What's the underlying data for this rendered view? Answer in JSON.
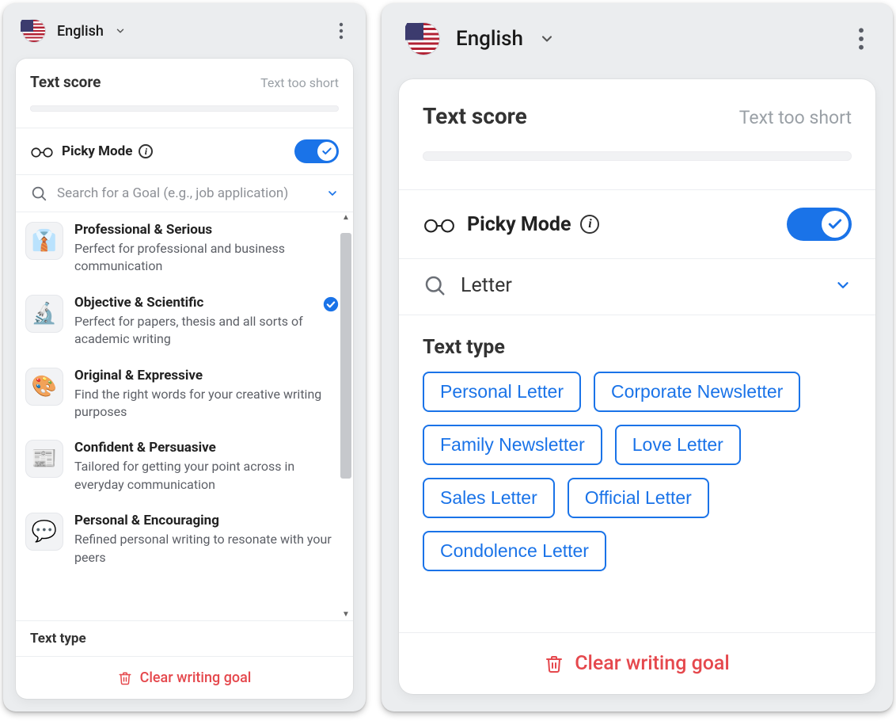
{
  "left": {
    "language": "English",
    "score_title": "Text score",
    "score_status": "Text too short",
    "picky_label": "Picky Mode",
    "search_placeholder": "Search for a Goal (e.g., job application)",
    "goals": [
      {
        "title": "Professional & Serious",
        "desc": "Perfect for professional and business communication"
      },
      {
        "title": "Objective & Scientific",
        "desc": "Perfect for papers, thesis and all sorts of academic writing",
        "selected": true
      },
      {
        "title": "Original & Expressive",
        "desc": "Find the right words for your creative writing purposes"
      },
      {
        "title": "Confident & Persuasive",
        "desc": "Tailored for getting your point across in everyday communication"
      },
      {
        "title": "Personal & Encouraging",
        "desc": "Refined personal writing to resonate with your peers"
      }
    ],
    "texttype_header": "Text type",
    "clear_label": "Clear writing goal"
  },
  "right": {
    "language": "English",
    "score_title": "Text score",
    "score_status": "Text too short",
    "picky_label": "Picky Mode",
    "search_value": "Letter",
    "section_title": "Text type",
    "chips": [
      "Personal Letter",
      "Corporate Newsletter",
      "Family Newsletter",
      "Love Letter",
      "Sales Letter",
      "Official Letter",
      "Condolence Letter"
    ],
    "clear_label": "Clear writing goal"
  },
  "icons": {
    "goal_emoji": [
      "👔",
      "🔬",
      "🎨",
      "📰",
      "💬"
    ]
  },
  "colors": {
    "accent": "#1a73e8",
    "danger": "#e5484d"
  }
}
